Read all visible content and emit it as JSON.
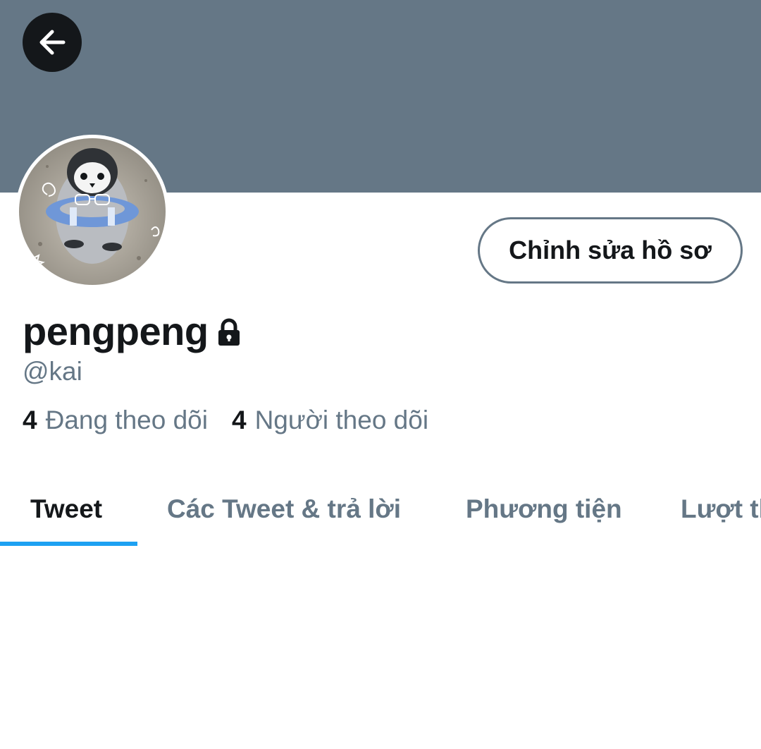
{
  "header": {
    "banner_color": "#657786",
    "back_icon": "arrow-left-icon"
  },
  "profile": {
    "avatar_description": "penguin-avatar",
    "display_name": "pengpeng",
    "protected_icon": "lock-icon",
    "handle": "@kai",
    "edit_button_label": "Chỉnh sửa hồ sơ"
  },
  "stats": {
    "following_count": "4",
    "following_label": "Đang theo dõi",
    "followers_count": "4",
    "followers_label": "Người theo dõi"
  },
  "tabs": [
    {
      "label": "Tweet",
      "active": true
    },
    {
      "label": "Các Tweet & trả lời",
      "active": false
    },
    {
      "label": "Phương tiện",
      "active": false
    },
    {
      "label": "Lượt thích",
      "active": false
    }
  ],
  "colors": {
    "accent": "#1da1f2",
    "text_primary": "#14171a",
    "text_secondary": "#657786"
  }
}
